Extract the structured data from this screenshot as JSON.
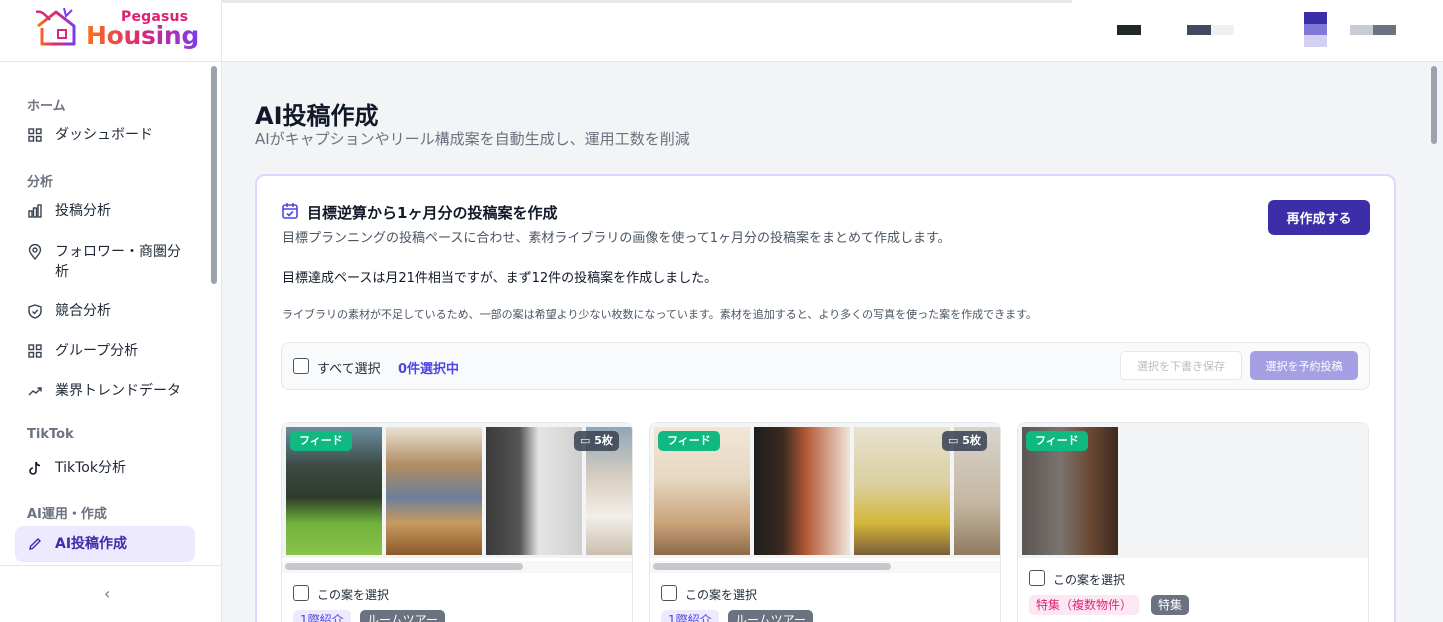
{
  "brand": {
    "name_small": "Pegasus",
    "name_large": "Housing"
  },
  "sidebar": {
    "sections": [
      {
        "label": "ホーム"
      },
      {
        "label": "分析"
      },
      {
        "label": "TikTok"
      },
      {
        "label": "AI運用・作成"
      }
    ],
    "items": [
      {
        "label": "ダッシュボード",
        "icon": "grid-icon"
      },
      {
        "label": "投稿分析",
        "icon": "bar-chart-icon"
      },
      {
        "label": "フォロワー・商圏分析",
        "icon": "map-pin-icon"
      },
      {
        "label": "競合分析",
        "icon": "shield-icon"
      },
      {
        "label": "グループ分析",
        "icon": "grid-icon"
      },
      {
        "label": "業界トレンドデータ",
        "icon": "trend-up-icon"
      },
      {
        "label": "TikTok分析",
        "icon": "tiktok-icon"
      },
      {
        "label": "AI投稿作成",
        "icon": "pencil-icon",
        "active": true
      }
    ],
    "collapse_icon": "chevron-left-icon"
  },
  "main": {
    "title": "AI投稿作成",
    "subtitle": "AIがキャプションやリール構成案を自動生成し、運用工数を削減"
  },
  "plan_card": {
    "title": "目標逆算から1ヶ月分の投稿案を作成",
    "description": "目標プランニングの投稿ペースに合わせ、素材ライブラリの画像を使って1ヶ月分の投稿案をまとめて作成します。",
    "summary": "目標達成ペースは月21件相当ですが、まず12件の投稿案を作成しました。",
    "note": "ライブラリの素材が不足しているため、一部の案は希望より少ない枚数になっています。素材を追加すると、より多くの写真を使った案を作成できます。",
    "regenerate_label": "再作成する",
    "select_all_label": "すべて選択",
    "selected_count": "0件選択中",
    "save_draft_label": "選択を下書き保存",
    "schedule_label": "選択を予約投稿"
  },
  "proposals": [
    {
      "type_badge": "フィード",
      "count_badge": "5枚",
      "select_label": "この案を選択",
      "tags": [
        "1際紹介",
        "ルームツアー"
      ]
    },
    {
      "type_badge": "フィード",
      "count_badge": "5枚",
      "select_label": "この案を選択",
      "tags": [
        "1際紹介",
        "ルームツアー"
      ]
    },
    {
      "type_badge": "フィード",
      "select_label": "この案を選択",
      "tags": [
        "特集（複数物件）",
        "特集"
      ]
    }
  ],
  "colors": {
    "accent": "#3b2ea8",
    "feed_badge": "#10b981",
    "active_bg": "#ede9fe"
  }
}
